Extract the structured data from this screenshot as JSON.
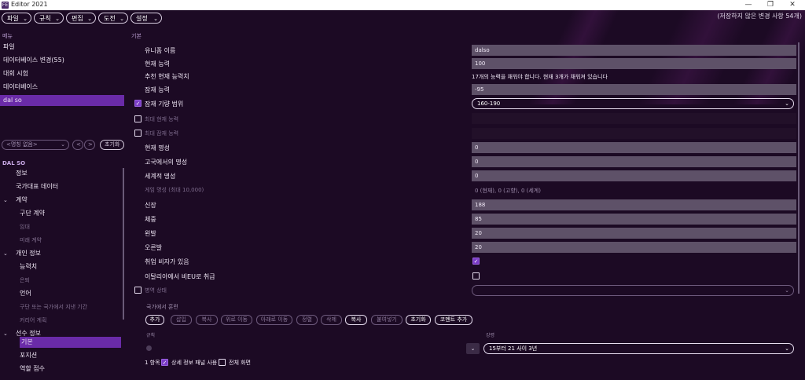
{
  "window": {
    "title": "Editor 2021",
    "app_icon": "FE",
    "minimize": "—",
    "restore": "❐",
    "close": "✕"
  },
  "menubar": {
    "items": [
      "파일",
      "규칙",
      "편집",
      "도전",
      "설정"
    ],
    "unsaved_text": "(저장하지 않은 변경 사항 54개)"
  },
  "left": {
    "menu_header": "메뉴",
    "menu_items": [
      "파일",
      "데이터베이스 변경(55)",
      "대회 시험",
      "데이터베이스",
      "dal so"
    ],
    "filter_placeholder": "<명칭 없음>",
    "filter_prev": "<",
    "filter_next": ">",
    "reset_label": "초기화",
    "player_name": "DAL SO",
    "nav": {
      "info": "정보",
      "national": "국가대표 데이터",
      "contract": "계약",
      "club_contract": "구단 계약",
      "loan": "임대",
      "future_contract": "미래 계약",
      "personal": "개인 정보",
      "ability": "능력치",
      "retire": "은퇴",
      "language": "언어",
      "nation_period": "구단 또는 국가에서 지낸 기간",
      "career_plan": "커리어 계획",
      "player_info": "선수 정보",
      "basic": "기본",
      "position": "포지션",
      "role_score": "역할 점수"
    }
  },
  "right": {
    "section": "기본",
    "rows": {
      "unique_name": {
        "label": "유니폼 이름",
        "value": "dalso"
      },
      "current_ability": {
        "label": "현재 능력",
        "value": "100"
      },
      "recommended_ca": {
        "label": "추천 현재 능력치",
        "value": "17개의 능력을 채워야 합니다. 현재 3개가 채워져 있습니다"
      },
      "potential": {
        "label": "잠재 능력",
        "value": "-95"
      },
      "potential_range": {
        "label": "잠재 기량 범위",
        "value": "160-190"
      },
      "max_current": {
        "label": "최대 현재 능력"
      },
      "max_potential": {
        "label": "최대 잠재 능력"
      },
      "current_rep": {
        "label": "현재 명성",
        "value": "0"
      },
      "home_rep": {
        "label": "고국에서의 명성",
        "value": "0"
      },
      "world_rep": {
        "label": "세계적 명성",
        "value": "0"
      },
      "game_rep": {
        "label": "게임 명성 (최대 10,000)",
        "value": "0 (현재), 0 (고향), 0 (세계)"
      },
      "height": {
        "label": "신장",
        "value": "188"
      },
      "weight": {
        "label": "체중",
        "value": "85"
      },
      "left_foot": {
        "label": "왼발",
        "value": "20"
      },
      "right_foot": {
        "label": "오른발",
        "value": "20"
      },
      "no_work_permit": {
        "label": "취업 비자가 있음"
      },
      "eu_italy": {
        "label": "이탈리아에서 비EU로 취급"
      },
      "military": {
        "label": "병역 상태"
      }
    },
    "training_header": "국가에서 훈련",
    "actions": [
      "추가",
      "삽입",
      "복사",
      "위로 이동",
      "아래로 이동",
      "정렬",
      "삭제",
      "복사",
      "붙여넣기",
      "초기화",
      "코멘트 추가"
    ],
    "rule_label": "규칙",
    "period_label": "강령",
    "period_value": "15부터 21 사이 3년",
    "bottom": {
      "count": "1 항목",
      "detail_panel": "상세 정보 패널 사용",
      "fullscreen": "전체 화면"
    }
  }
}
